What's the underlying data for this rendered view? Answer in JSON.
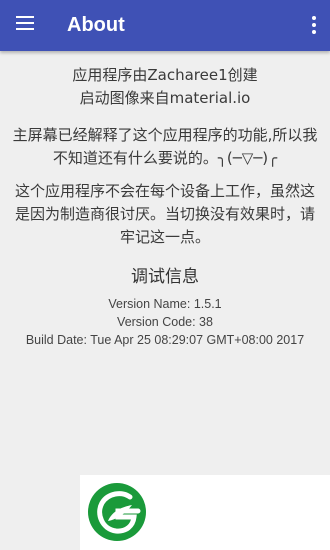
{
  "app_bar": {
    "title": "About",
    "menu_icon": "hamburger-menu-icon",
    "overflow_icon": "more-vert-icon",
    "color": "#3f51b5"
  },
  "about": {
    "credit_line_1": "应用程序由Zacharee1创建",
    "credit_line_2": "启动图像来自material.io",
    "description": "主屏幕已经解释了这个应用程序的功能,所以我不知道还有什么要说的。╮(─▽─)╭",
    "warning": "这个应用程序不会在每个设备上工作，虽然这是因为制造商很讨厌。当切换没有效果时，请牢记这一点。"
  },
  "debug": {
    "title": "调试信息",
    "version_name": "Version Name: 1.5.1",
    "version_code": "Version Code: 38",
    "build_date": "Build Date: Tue Apr 25 08:29:07 GMT+08:00 2017"
  },
  "ad": {
    "logo_icon": "green-leaf-logo-icon",
    "logo_color": "#1a9a3a"
  }
}
